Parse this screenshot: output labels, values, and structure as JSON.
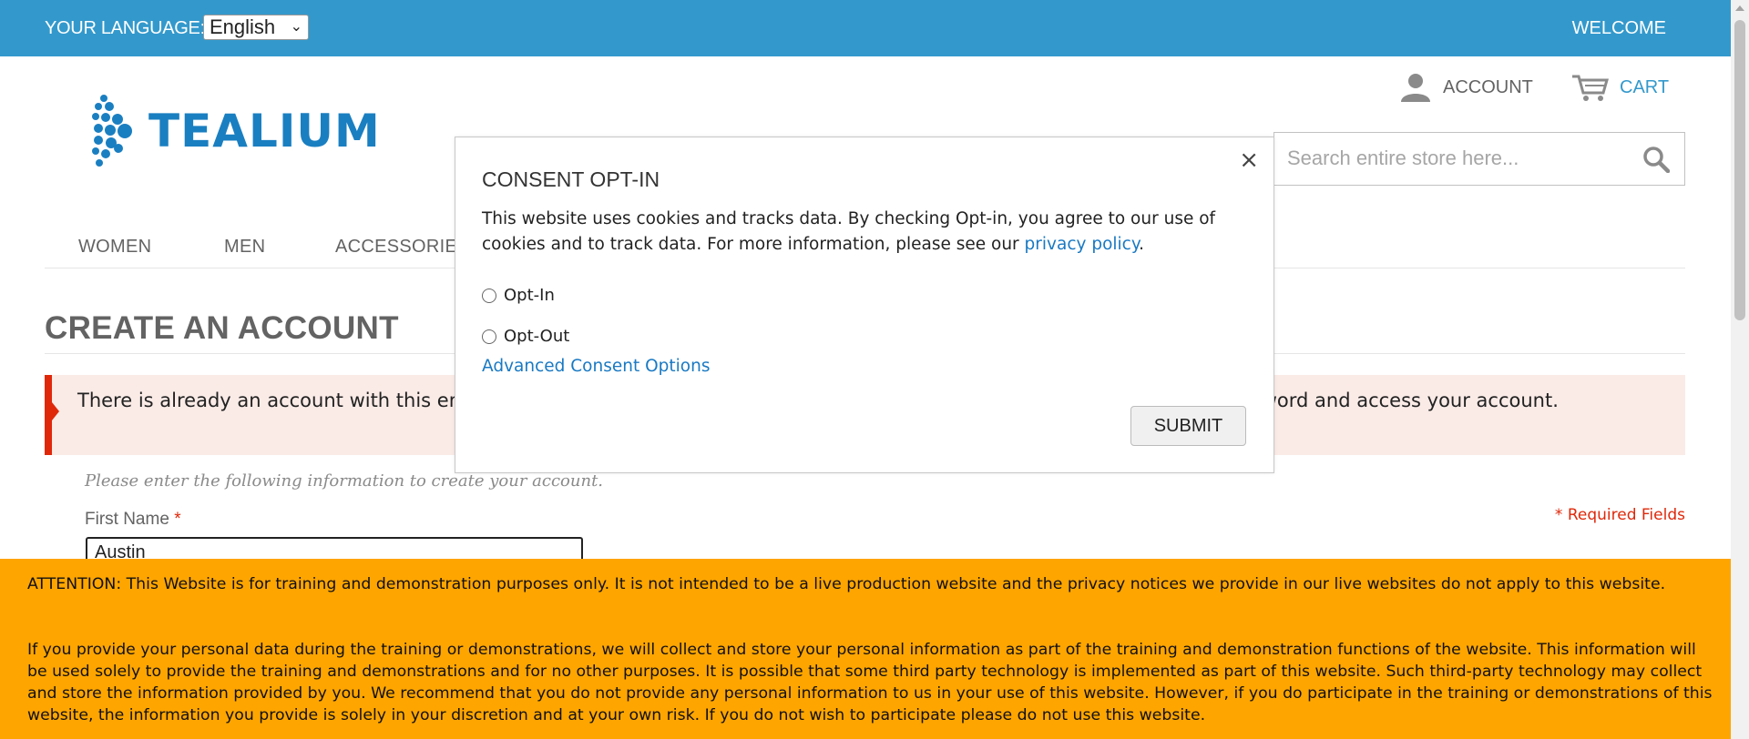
{
  "topbar": {
    "language_label": "YOUR LANGUAGE:",
    "language_selected": "English",
    "welcome": "WELCOME",
    "bg_color": "#3399cc"
  },
  "brand": {
    "name": "TEALIUM",
    "color": "#1a7fc1"
  },
  "header": {
    "account_label": "ACCOUNT",
    "account_icon": "user-icon",
    "cart_label": "CART",
    "cart_icon": "cart-icon",
    "search_placeholder": "Search entire store here...",
    "search_icon": "search-icon"
  },
  "nav": {
    "items": [
      "WOMEN",
      "MEN",
      "ACCESSORIES"
    ]
  },
  "page": {
    "title": "CREATE AN ACCOUNT",
    "error_message": "There is already an account with this email address. If you are sure that it is your email address, click here to get your password and access your account.",
    "form_intro": "Please enter the following information to create your account.",
    "first_name_label": "First Name",
    "required_marker": "*",
    "required_fields": "* Required Fields",
    "first_name_value": "Austin"
  },
  "consent_modal": {
    "title": "CONSENT OPT-IN",
    "close_label": "×",
    "body_text": "This website uses cookies and tracks data. By checking Opt-in, you agree to our use of cookies and to track data. For more information, please see our ",
    "privacy_link": "privacy policy",
    "body_end": ".",
    "options": [
      "Opt-In",
      "Opt-Out"
    ],
    "advanced_link": "Advanced Consent Options",
    "submit_label": "SUBMIT"
  },
  "attention_banner": {
    "paragraph1": "ATTENTION: This Website is for training and demonstration purposes only. It is not intended to be a live production website and the privacy notices we provide in our live websites do not apply to this website.",
    "paragraph2": "If you provide your personal data during the training or demonstrations, we will collect and store your personal information as part of the training and demonstration functions of the website. This information will be used solely to provide the training and demonstrations and for no other purposes. It is possible that some third party technology is implemented as part of this website. Such third-party technology may collect and store the information provided by you. We recommend that you do not provide any personal information to us in your use of this website. However, if you do participate in the training or demonstrations of this website, the information you provide is solely in your discretion and at your own risk. If you do not wish to participate please do not use this website.",
    "bg_color": "#ffa500"
  }
}
